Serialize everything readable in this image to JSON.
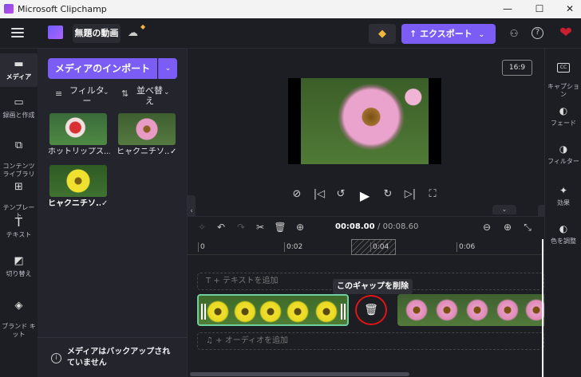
{
  "window": {
    "title": "Microsoft Clipchamp",
    "min": "—",
    "max": "☐",
    "close": "✕"
  },
  "topbar": {
    "project_name": "無題の動画",
    "export_label": "エクスポート",
    "export_icon": "↑",
    "chevron": "⌄",
    "gem_icon": "diamond-icon",
    "gem_glyph": "◆",
    "heart_glyph": "❤",
    "share_glyph": "⚇",
    "help_glyph": "?",
    "cloud_glyph": "☁"
  },
  "left_rail": {
    "items": [
      {
        "label": "メディア",
        "icon": "▬"
      },
      {
        "label": "録画と作成",
        "icon": "▭"
      },
      {
        "label": "コンテンツ\nライブラリ",
        "icon": "⧉"
      },
      {
        "label": "テンプレー\nト",
        "icon": "⊞"
      },
      {
        "label": "テキスト",
        "icon": "T"
      },
      {
        "label": "切り替え",
        "icon": "◩"
      },
      {
        "label": "ブランド キ\nット",
        "icon": "◈"
      }
    ]
  },
  "media_panel": {
    "import_label": "メディアのインポート",
    "import_chevron": "⌄",
    "filter_label": "フィルタ\nー",
    "sort_label": "並べ替\nえ",
    "filter_icon": "≡",
    "sort_icon": "⇅",
    "chevron": "⌄",
    "items": [
      {
        "label": "ホットリップス..."
      },
      {
        "label": "ヒャクニチソ...",
        "check": "✓"
      },
      {
        "label": "ヒャクニチソ...",
        "check": "✓"
      }
    ],
    "backup_text": "メディアはバックアップされていません",
    "info_glyph": "i",
    "backup_chevron": "⌃"
  },
  "preview": {
    "aspect_ratio": "16:9",
    "controls": [
      "⊘",
      "|◁",
      "↺",
      "▶",
      "↻",
      "▷|",
      "⛶"
    ],
    "collapse_glyph": "‹",
    "chev_down": "⌄"
  },
  "right_rail": {
    "items": [
      {
        "label": "キャプショ\nン",
        "icon": "CC"
      },
      {
        "label": "フェード",
        "icon": "◐"
      },
      {
        "label": "フィルター",
        "icon": "◑"
      },
      {
        "label": "効果",
        "icon": "✦"
      },
      {
        "label": "色を調整",
        "icon": "◐"
      }
    ]
  },
  "timeline": {
    "tools": [
      "✧",
      "↶",
      "↷",
      "✂",
      "🗑",
      "⊕"
    ],
    "time_current": "00:08.00",
    "time_total": "/ 00:08.60",
    "zoom_out": "⊖",
    "zoom_in": "⊕",
    "fit": "⤡",
    "ticks": [
      "0",
      "0:02",
      "0:04",
      "0:06"
    ],
    "text_lane": "T  + テキストを追加",
    "audio_lane": "♫  + オーディオを追加",
    "tooltip": "このギャップを削除",
    "trash_glyph": "🗑"
  }
}
